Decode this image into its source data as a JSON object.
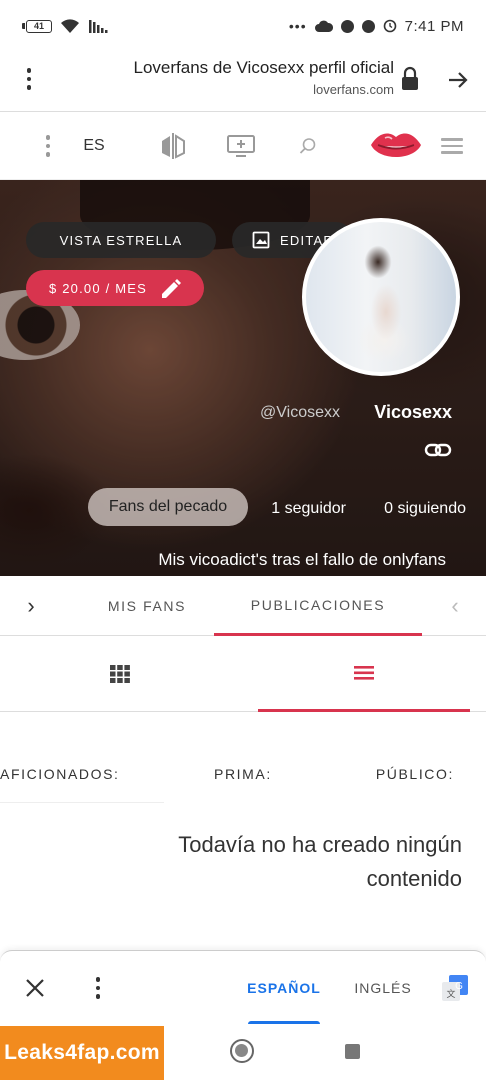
{
  "status_bar": {
    "battery": "41",
    "time": "7:41 PM",
    "icons": [
      "battery-icon",
      "wifi-icon",
      "signal-icon",
      "more-dots-icon",
      "cloud-icon",
      "messenger-icon",
      "messenger-icon",
      "alarm-icon"
    ]
  },
  "browser": {
    "page_title": "Loverfans de Vicosexx perfil oficial",
    "domain": "loverfans.com"
  },
  "site_nav": {
    "language": "ES",
    "icons": [
      "menu-icon",
      "lips-logo-icon",
      "search-icon",
      "screen-icon",
      "mirror-icon",
      "more-icon"
    ]
  },
  "profile": {
    "vista_estrella": "VISTA ESTRELLA",
    "editar": "EDITAR",
    "price": "$ 20.00 / MES",
    "display_name": "Vicosexx",
    "handle": "@Vicosexx",
    "following": "0 siguiendo",
    "followers": "1 seguidor",
    "fans_button": "Fans del pecado",
    "bio": "Mis vicoadict's tras el fallo de onlyfans"
  },
  "tabs": {
    "publicaciones": "PUBLICACIONES",
    "mis_fans": "MIS FANS"
  },
  "audience": {
    "publico": "PÚBLICO:",
    "prima": "PRIMA:",
    "aficionados": "AFICIONADOS:"
  },
  "empty_state": "Todavía no ha creado ningún contenido",
  "translate_bar": {
    "ingles": "INGLÉS",
    "espanol": "ESPAÑOL"
  },
  "watermark": "Leaks4fap.com",
  "colors": {
    "accent": "#d8344e",
    "translate_blue": "#1a73e8",
    "watermark_orange": "#f28b1e"
  }
}
